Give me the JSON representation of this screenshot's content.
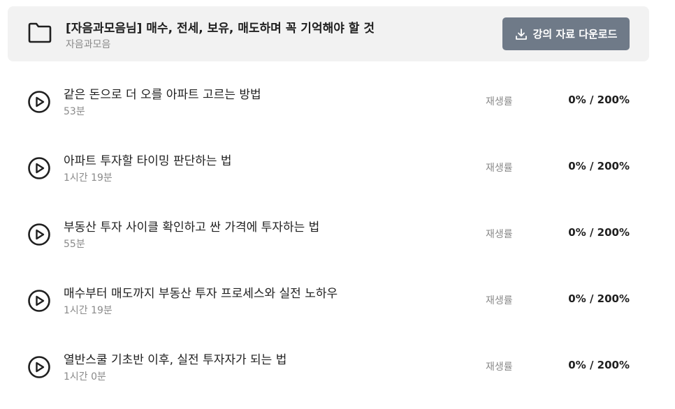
{
  "course": {
    "title": "[자음과모음님] 매수, 전세, 보유, 매도하며 꼭 기억해야 할 것",
    "author": "자음과모음",
    "folder_icon": "folder-icon",
    "download_label": "강의 자료 다운로드",
    "download_icon": "download-icon",
    "button_color": "#6f7a88"
  },
  "lessons": [
    {
      "title": "같은 돈으로 더 오를 아파트 고르는 방법",
      "duration": "53분",
      "progress_label": "재생률",
      "progress": "0% / 200%"
    },
    {
      "title": "아파트 투자할 타이밍 판단하는 법",
      "duration": "1시간 19분",
      "progress_label": "재생률",
      "progress": "0% / 200%"
    },
    {
      "title": "부동산 투자 사이클 확인하고 싼 가격에 투자하는 법",
      "duration": "55분",
      "progress_label": "재생률",
      "progress": "0% / 200%"
    },
    {
      "title": "매수부터 매도까지 부동산 투자 프로세스와 실전 노하우",
      "duration": "1시간 19분",
      "progress_label": "재생률",
      "progress": "0% / 200%"
    },
    {
      "title": "열반스쿨 기초반 이후, 실전 투자자가 되는 법",
      "duration": "1시간 0분",
      "progress_label": "재생률",
      "progress": "0% / 200%"
    }
  ]
}
